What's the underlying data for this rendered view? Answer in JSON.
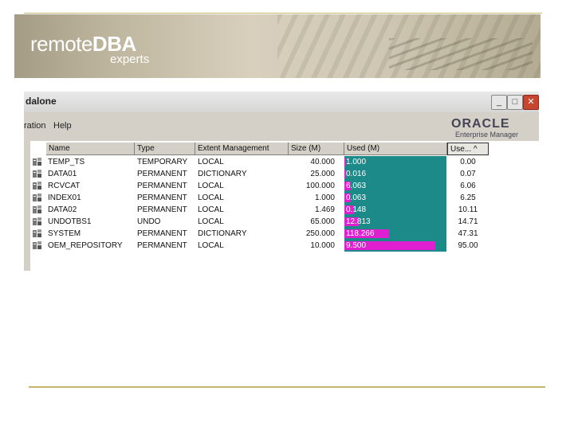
{
  "banner": {
    "logo_main_a": "remote",
    "logo_main_b": "DBA",
    "logo_sub": "experts"
  },
  "window": {
    "title": "dalone",
    "buttons": {
      "minimize": "_",
      "maximize": "□",
      "close": "✕"
    },
    "menu": [
      "ration",
      "Help"
    ],
    "brand": {
      "name": "ORACLE",
      "sub": "Enterprise Manager"
    }
  },
  "table": {
    "columns": [
      "Name",
      "Type",
      "Extent Management",
      "Size (M)",
      "Used (M)",
      "Use... ^"
    ],
    "rows": [
      {
        "name": "TEMP_TS",
        "type": "TEMPORARY",
        "extent": "LOCAL",
        "size": "40.000",
        "used": "1.000",
        "use": "0.00",
        "fill": 0.0
      },
      {
        "name": "DATA01",
        "type": "PERMANENT",
        "extent": "DICTIONARY",
        "size": "25.000",
        "used": "0.016",
        "use": "0.07",
        "fill": 0.01
      },
      {
        "name": "RCVCAT",
        "type": "PERMANENT",
        "extent": "LOCAL",
        "size": "100.000",
        "used": "6.063",
        "use": "6.06",
        "fill": 0.06
      },
      {
        "name": "INDEX01",
        "type": "PERMANENT",
        "extent": "LOCAL",
        "size": "1.000",
        "used": "0.063",
        "use": "6.25",
        "fill": 0.06
      },
      {
        "name": "DATA02",
        "type": "PERMANENT",
        "extent": "LOCAL",
        "size": "1.469",
        "used": "0.148",
        "use": "10.11",
        "fill": 0.1
      },
      {
        "name": "UNDOTBS1",
        "type": "UNDO",
        "extent": "LOCAL",
        "size": "65.000",
        "used": "12.813",
        "use": "14.71",
        "fill": 0.15
      },
      {
        "name": "SYSTEM",
        "type": "PERMANENT",
        "extent": "DICTIONARY",
        "size": "250.000",
        "used": "118.266",
        "use": "47.31",
        "fill": 0.47
      },
      {
        "name": "OEM_REPOSITORY",
        "type": "PERMANENT",
        "extent": "LOCAL",
        "size": "10.000",
        "used": "9.500",
        "use": "95.00",
        "fill": 0.95
      }
    ]
  },
  "colors": {
    "accent_rule": "#c8b46a",
    "used_bg": "#1d8a8a",
    "used_bar": "#e020d0"
  }
}
